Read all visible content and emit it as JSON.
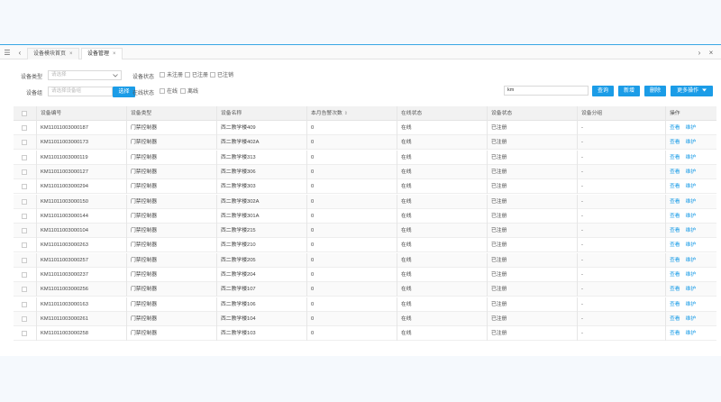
{
  "tabs": [
    {
      "label": "设备模块首页",
      "close": "×",
      "active": false
    },
    {
      "label": "设备管理",
      "close": "×",
      "active": true
    }
  ],
  "tabbar": {
    "menu_glyph": "☰",
    "prev_glyph": "‹",
    "next_glyph": "›",
    "close_glyph": "×"
  },
  "filter": {
    "device_type_label": "设备类型",
    "device_type_placeholder": "请选择",
    "device_group_label": "设备组",
    "device_group_placeholder": "请选择设备组",
    "select_button": "选择",
    "device_status_label": "设备状态",
    "status_options": [
      "未注册",
      "已注册",
      "已注销"
    ],
    "online_status_label": "在线状态",
    "online_options": [
      "在线",
      "离线"
    ],
    "search_value": "km",
    "query_button": "查询",
    "add_button": "新增",
    "delete_button": "删除",
    "more_button": "更多操作"
  },
  "table": {
    "headers": [
      "设备编号",
      "设备类型",
      "设备名称",
      "本月告警次数",
      "在线状态",
      "设备状态",
      "设备分组",
      "操作"
    ],
    "action_view": "查看",
    "action_maintain": "维护",
    "rows": [
      [
        "KM11011003000187",
        "门禁控制器",
        "西二教学楼409",
        "0",
        "在线",
        "已注册",
        "-"
      ],
      [
        "KM11011003000173",
        "门禁控制器",
        "西二教学楼402A",
        "0",
        "在线",
        "已注册",
        "-"
      ],
      [
        "KM11011003000119",
        "门禁控制器",
        "西二教学楼313",
        "0",
        "在线",
        "已注册",
        "-"
      ],
      [
        "KM11011003000127",
        "门禁控制器",
        "西二教学楼306",
        "0",
        "在线",
        "已注册",
        "-"
      ],
      [
        "KM11011003000294",
        "门禁控制器",
        "西二教学楼303",
        "0",
        "在线",
        "已注册",
        "-"
      ],
      [
        "KM11011003000150",
        "门禁控制器",
        "西二教学楼302A",
        "0",
        "在线",
        "已注册",
        "-"
      ],
      [
        "KM11011003000144",
        "门禁控制器",
        "西二教学楼301A",
        "0",
        "在线",
        "已注册",
        "-"
      ],
      [
        "KM11011003000104",
        "门禁控制器",
        "西二教学楼215",
        "0",
        "在线",
        "已注册",
        "-"
      ],
      [
        "KM11011003000263",
        "门禁控制器",
        "西二教学楼210",
        "0",
        "在线",
        "已注册",
        "-"
      ],
      [
        "KM11011003000257",
        "门禁控制器",
        "西二教学楼205",
        "0",
        "在线",
        "已注册",
        "-"
      ],
      [
        "KM11011003000237",
        "门禁控制器",
        "西二教学楼204",
        "0",
        "在线",
        "已注册",
        "-"
      ],
      [
        "KM11011003000256",
        "门禁控制器",
        "西二教学楼107",
        "0",
        "在线",
        "已注册",
        "-"
      ],
      [
        "KM11011003000163",
        "门禁控制器",
        "西二教学楼106",
        "0",
        "在线",
        "已注册",
        "-"
      ],
      [
        "KM11011003000261",
        "门禁控制器",
        "西二教学楼104",
        "0",
        "在线",
        "已注册",
        "-"
      ],
      [
        "KM11011003000258",
        "门禁控制器",
        "西二教学楼103",
        "0",
        "在线",
        "已注册",
        "-"
      ]
    ]
  },
  "colors": {
    "accent": "#1b9ce7",
    "header_bg": "#f2f2f2",
    "border": "#e3e3e3"
  }
}
